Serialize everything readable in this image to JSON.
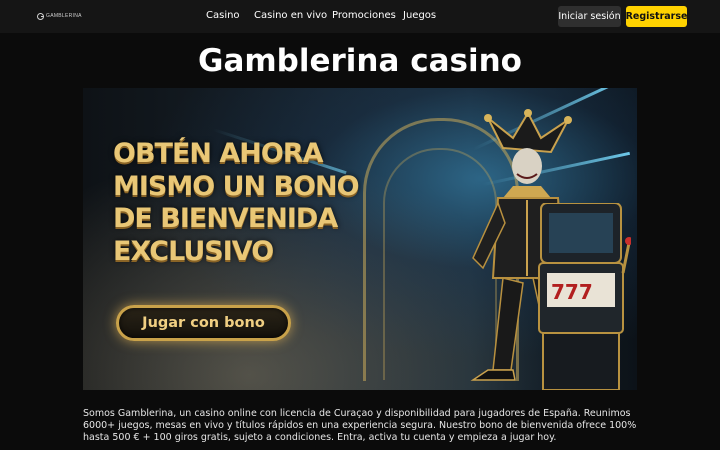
{
  "header": {
    "logo_text": "GAMBLERINA",
    "nav": [
      "Casino",
      "Casino en vivo",
      "Promociones",
      "Juegos"
    ],
    "login_label": "Iniciar sesión",
    "register_label": "Registrarse"
  },
  "page": {
    "title": "Gamblerina casino"
  },
  "hero": {
    "headline_lines": [
      "OBTÉN AHORA",
      "MISMO UN BONO",
      "DE BIENVENIDA",
      "EXCLUSIVO"
    ],
    "cta_label": "Jugar con bono"
  },
  "description": "Somos Gamblerina, un casino online con licencia de Curaçao y disponibilidad para jugadores de España. Reunimos 6000+ juegos, mesas en vivo y títulos rápidos en una experiencia segura. Nuestro bono de bienvenida ofrece 100% hasta 500 € + 100 giros gratis, sujeto a condiciones. Entra, activa tu cuenta y empieza a jugar hoy.",
  "colors": {
    "accent_yellow": "#ffd200",
    "gold": "#e9c776",
    "background": "#0b0b0b"
  }
}
